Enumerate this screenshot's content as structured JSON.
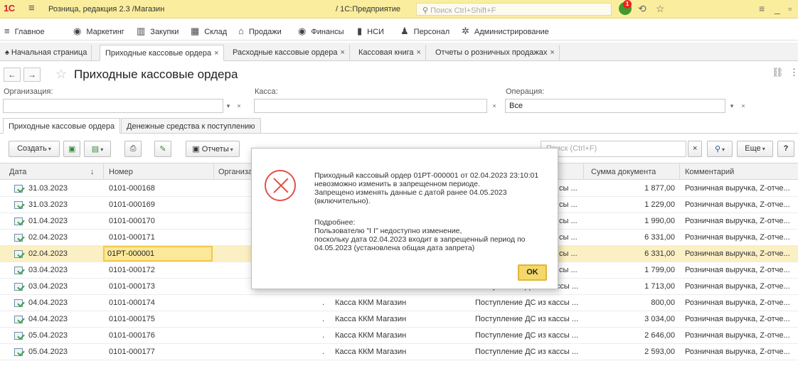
{
  "titlebar": {
    "logo": "1С",
    "title": "Розница, редакция 2.3 /Магазин",
    "app": "/ 1С:Предприятие",
    "search_placeholder": "Поиск Ctrl+Shift+F",
    "notifications_count": "1"
  },
  "sections": [
    {
      "label": "Главное",
      "icon": "menu-icon"
    },
    {
      "label": "Маркетинг",
      "icon": "marketing-icon"
    },
    {
      "label": "Закупки",
      "icon": "purchases-icon"
    },
    {
      "label": "Склад",
      "icon": "warehouse-icon"
    },
    {
      "label": "Продажи",
      "icon": "sales-icon"
    },
    {
      "label": "Финансы",
      "icon": "finance-icon"
    },
    {
      "label": "НСИ",
      "icon": "reference-icon"
    },
    {
      "label": "Персонал",
      "icon": "personnel-icon"
    },
    {
      "label": "Администрирование",
      "icon": "gear-icon"
    }
  ],
  "open_tabs": [
    {
      "label": "Начальная страница"
    },
    {
      "label": "Приходные кассовые ордера"
    },
    {
      "label": "Расходные кассовые ордера"
    },
    {
      "label": "Кассовая книга"
    },
    {
      "label": "Отчеты о розничных продажах"
    }
  ],
  "form": {
    "title": "Приходные кассовые ордера",
    "filters": {
      "org_label": "Организация:",
      "org_value": "",
      "kassa_label": "Касса:",
      "kassa_value": "",
      "operation_label": "Операция:",
      "operation_value": "Все"
    },
    "tabs": [
      {
        "label": "Приходные кассовые ордера"
      },
      {
        "label": "Денежные средства к поступлению"
      }
    ],
    "commands": {
      "create": "Создать",
      "reports": "Отчеты",
      "search_placeholder": "Поиск (Ctrl+F)",
      "more": "Еще",
      "help": "?"
    }
  },
  "table": {
    "columns": [
      "Дата",
      "Номер",
      "Организа",
      "Сумма документа",
      "Комментарий"
    ],
    "rows": [
      {
        "date": "31.03.2023",
        "number": "0101-000168",
        "kassa": "",
        "operation": "сы ...",
        "sum": "1 877,00",
        "comment": "Розничная выручка, Z-отче..."
      },
      {
        "date": "31.03.2023",
        "number": "0101-000169",
        "kassa": "",
        "operation": "сы ...",
        "sum": "1 229,00",
        "comment": "Розничная выручка, Z-отче..."
      },
      {
        "date": "01.04.2023",
        "number": "0101-000170",
        "kassa": "",
        "operation": "сы ...",
        "sum": "1 990,00",
        "comment": "Розничная выручка, Z-отче..."
      },
      {
        "date": "02.04.2023",
        "number": "0101-000171",
        "kassa": "",
        "operation": "сы ...",
        "sum": "6 331,00",
        "comment": "Розничная выручка, Z-отче..."
      },
      {
        "date": "02.04.2023",
        "number": "01РТ-000001",
        "kassa": "",
        "operation": "сы ...",
        "sum": "6 331,00",
        "comment": "Розничная выручка, Z-отче..."
      },
      {
        "date": "03.04.2023",
        "number": "0101-000172",
        "kassa": "",
        "operation": "сы ...",
        "sum": "1 799,00",
        "comment": "Розничная выручка, Z-отче..."
      },
      {
        "date": "03.04.2023",
        "number": "0101-000173",
        "kassa": "Касса ККМ Магазин",
        "operation": "Поступление ДС из кассы ...",
        "sum": "1 713,00",
        "comment": "Розничная выручка, Z-отче..."
      },
      {
        "date": "04.04.2023",
        "number": "0101-000174",
        "kassa": "Касса ККМ Магазин",
        "operation": "Поступление ДС из кассы ...",
        "sum": "800,00",
        "comment": "Розничная выручка, Z-отче..."
      },
      {
        "date": "04.04.2023",
        "number": "0101-000175",
        "kassa": "Касса ККМ Магазин",
        "operation": "Поступление ДС из кассы ...",
        "sum": "3 034,00",
        "comment": "Розничная выручка, Z-отче..."
      },
      {
        "date": "05.04.2023",
        "number": "0101-000176",
        "kassa": "Касса ККМ Магазин",
        "operation": "Поступление ДС из кассы ...",
        "sum": "2 646,00",
        "comment": "Розничная выручка, Z-отче..."
      },
      {
        "date": "05.04.2023",
        "number": "0101-000177",
        "kassa": "Касса ККМ Магазин",
        "operation": "Поступление ДС из кассы ...",
        "sum": "2 593,00",
        "comment": "Розничная выручка, Z-отче..."
      }
    ]
  },
  "dialog": {
    "line1": "Приходный кассовый ордер 01РТ-000001 от 02.04.2023 23:10:01",
    "line2": "невозможно изменить в запрещенном периоде.",
    "line3": "Запрещено изменять данные с датой ранее 04.05.2023",
    "line4": "(включительно).",
    "details_label": "Подробнее:",
    "details1": "Пользователю \"I                        I\" недоступно изменение,",
    "details2": "поскольку дата 02.04.2023 входит в запрещенный период по",
    "details3": "04.05.2023 (установлена общая дата запрета)",
    "ok": "OK"
  }
}
